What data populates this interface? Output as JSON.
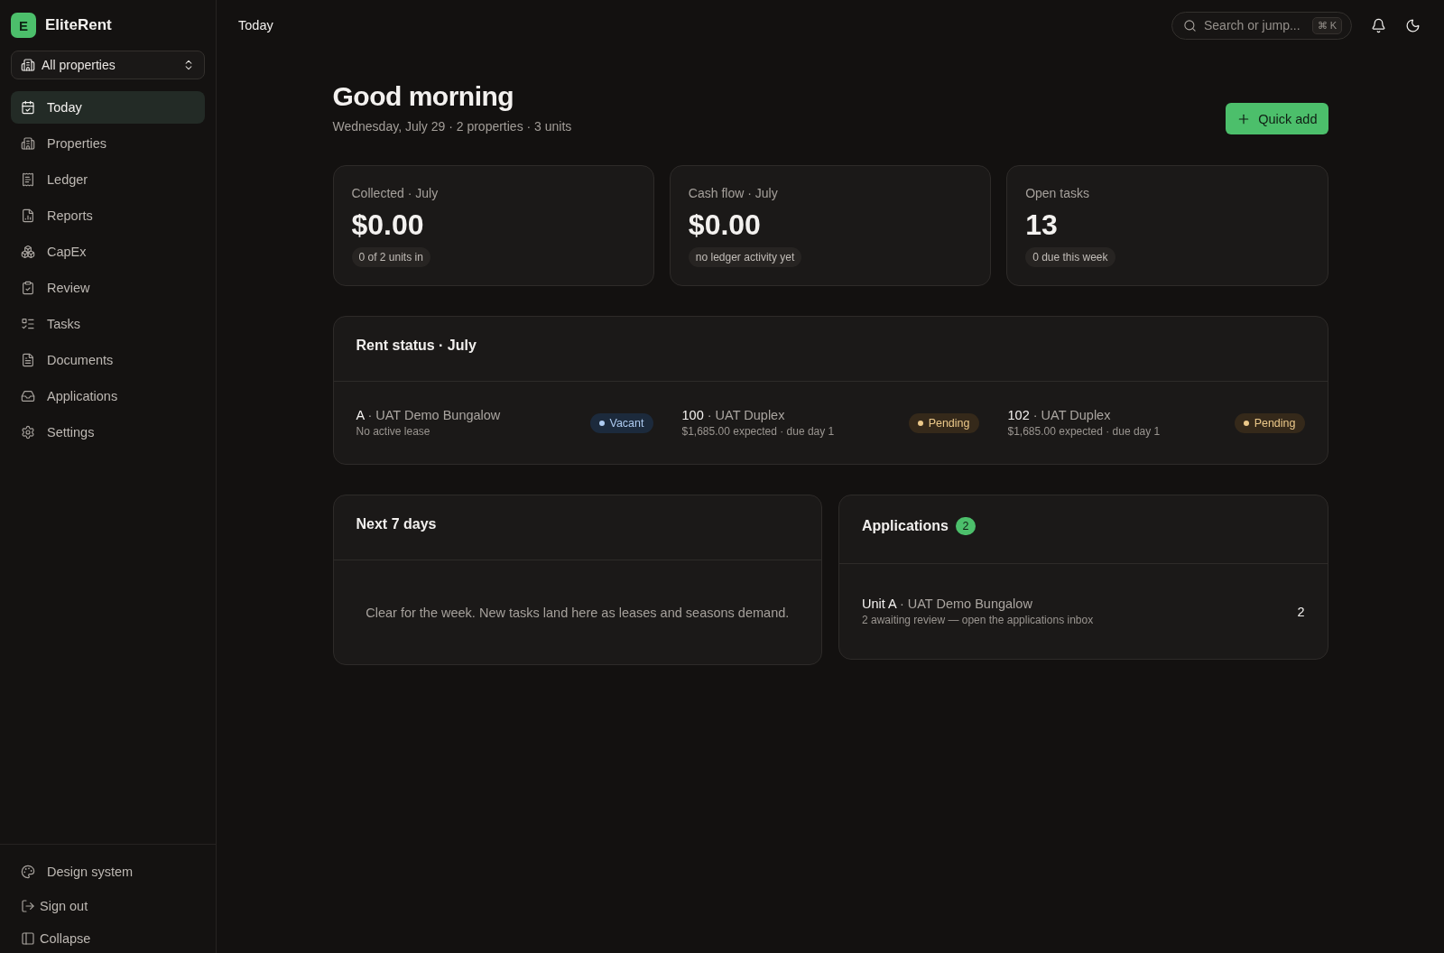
{
  "sidebar": {
    "brand": {
      "logo_letter": "E",
      "name": "EliteRent"
    },
    "property_selector": {
      "value": "All properties"
    },
    "nav_items": [
      {
        "label": "Today",
        "selected": true
      },
      {
        "label": "Properties",
        "selected": false
      },
      {
        "label": "Ledger",
        "selected": false
      },
      {
        "label": "Reports",
        "selected": false
      },
      {
        "label": "CapEx",
        "selected": false
      },
      {
        "label": "Review",
        "selected": false
      },
      {
        "label": "Tasks",
        "selected": false
      },
      {
        "label": "Documents",
        "selected": false
      },
      {
        "label": "Applications",
        "selected": false
      },
      {
        "label": "Settings",
        "selected": false
      }
    ],
    "footer_items": [
      {
        "label": "Design system",
        "kind": "page"
      },
      {
        "label": "Sign out",
        "kind": "action"
      },
      {
        "label": "Collapse",
        "kind": "action"
      }
    ]
  },
  "top_bar": {
    "title": "Today",
    "search": {
      "placeholder": "Search or jump...",
      "shortcut": "⌘ K"
    }
  },
  "header": {
    "greeting": "Good morning",
    "subtitle": "Wednesday, July 29 · 2 properties · 3 units",
    "quick_add": "Quick add"
  },
  "stats": [
    {
      "label": "Collected · July",
      "value": "$0.00",
      "note": "0 of 2 units in"
    },
    {
      "label": "Cash flow · July",
      "value": "$0.00",
      "note": "no ledger activity yet"
    },
    {
      "label": "Open tasks",
      "value": "13",
      "note": "0 due this week"
    }
  ],
  "rent_status": {
    "title": "Rent status · July",
    "units": [
      {
        "name": "**A** · UAT Demo Bungalow",
        "detail": "No active lease",
        "status": "Vacant",
        "kind": "vacant"
      },
      {
        "name": "**100** · UAT Duplex",
        "detail": "$1,685.00 expected · due day 1",
        "status": "Pending",
        "kind": "pending"
      },
      {
        "name": "**102** · UAT Duplex",
        "detail": "$1,685.00 expected · due day 1",
        "status": "Pending",
        "kind": "pending"
      }
    ]
  },
  "next_7_days": {
    "title": "Next 7 days",
    "empty_message": "Clear for the week. New tasks land here as leases and seasons demand."
  },
  "applications": {
    "title": "Applications",
    "count": "2",
    "items": [
      {
        "name": "**Unit A** · UAT Demo Bungalow",
        "detail": "2 awaiting review — open the applications inbox",
        "count": "2"
      }
    ]
  }
}
